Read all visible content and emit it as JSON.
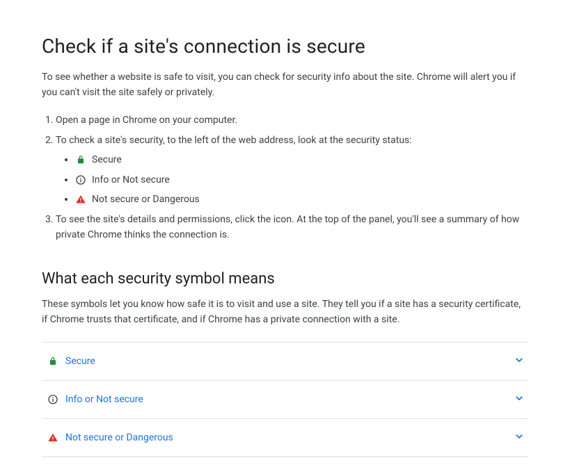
{
  "title": "Check if a site's connection is secure",
  "intro": "To see whether a website is safe to visit, you can check for security info about the site. Chrome will alert you if you can't visit the site safely or privately.",
  "steps": {
    "s1": "Open a page in Chrome on your computer.",
    "s2": "To check a site's security, to the left of the web address, look at the security status:",
    "s3": "To see the site's details and permissions, click the icon. At the top of the panel, you'll see a summary of how private Chrome thinks the connection is."
  },
  "statuses": {
    "secure": "Secure",
    "info": "Info or Not secure",
    "danger": "Not secure or Dangerous"
  },
  "section2": {
    "heading": "What each security symbol means",
    "intro": "These symbols let you know how safe it is to visit and use a site. They tell you if a site has a security certificate, if Chrome trusts that certificate, and if Chrome has a private connection with a site."
  },
  "accordion": {
    "a1": "Secure",
    "a2": "Info or Not secure",
    "a3": "Not secure or Dangerous"
  },
  "colors": {
    "link": "#1a73e8",
    "secure": "#1e8e3e",
    "info": "#3c4043",
    "danger": "#d93025"
  }
}
